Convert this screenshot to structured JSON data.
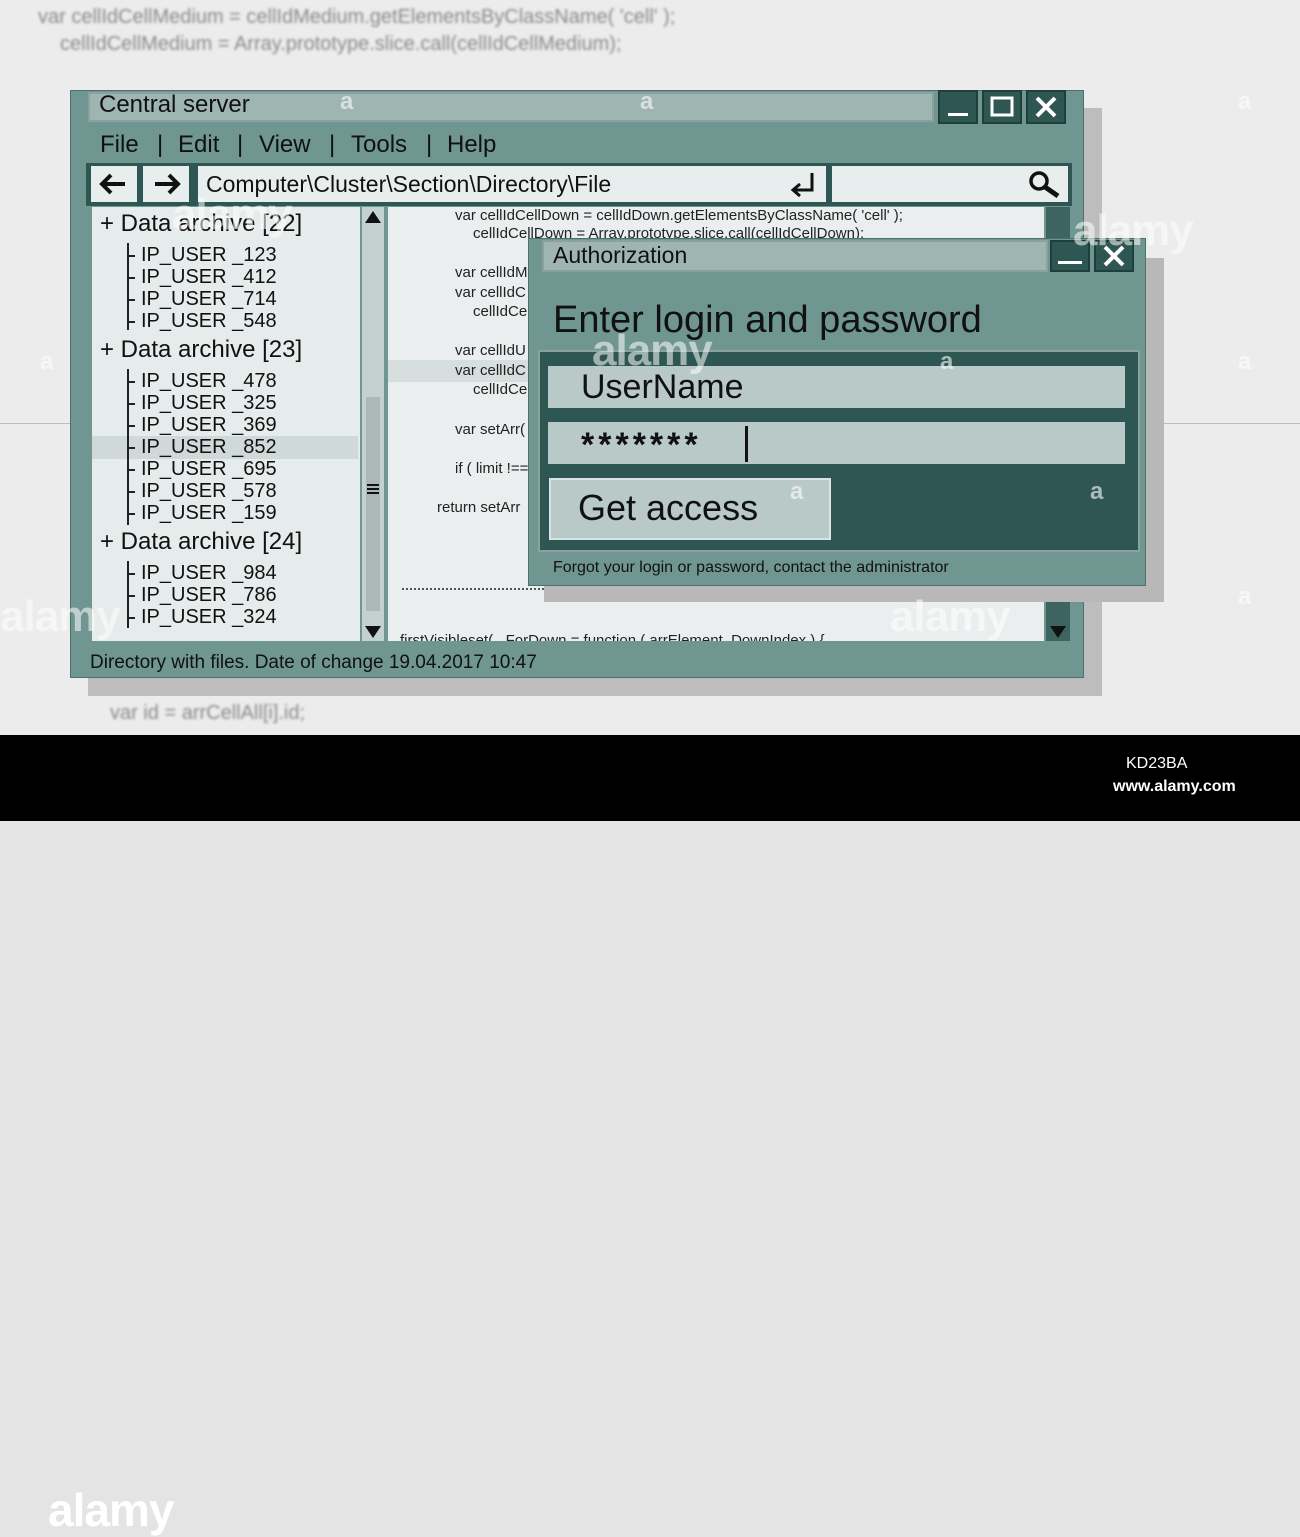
{
  "background_code": [
    "var cellIdCellMedium = cellIdMedium.getElementsByClassName( 'cell' );",
    "cellIdCellMedium = Array.prototype.slice.call(cellIdCellMedium);",
    "var id = arrCellAll[i].id;"
  ],
  "window": {
    "title": "Central server",
    "buttons": {
      "minimize": "_",
      "maximize": "□",
      "close": "X"
    }
  },
  "menu": [
    {
      "label": "File"
    },
    {
      "label": "Edit"
    },
    {
      "label": "View"
    },
    {
      "label": "Tools"
    },
    {
      "label": "Help"
    }
  ],
  "menu_separator": "|",
  "toolbar": {
    "back_icon": "arrow-left-icon",
    "forward_icon": "arrow-right-icon",
    "path": "Computer\\Cluster\\Section\\Directory\\File",
    "enter_icon": "enter-return-icon",
    "search_icon": "magnifier-icon",
    "search_value": ""
  },
  "tree": [
    {
      "label": "+ Data archive [22]",
      "users": [
        "IP_USER _123",
        "IP_USER _412",
        "IP_USER _714",
        "IP_USER _548"
      ]
    },
    {
      "label": "+ Data archive [23]",
      "users": [
        "IP_USER _478",
        "IP_USER _325",
        "IP_USER _369",
        "IP_USER _852",
        "IP_USER _695",
        "IP_USER _578",
        "IP_USER _159"
      ]
    },
    {
      "label": "+ Data archive [24]",
      "users": [
        "IP_USER _984",
        "IP_USER _786",
        "IP_USER _324"
      ]
    }
  ],
  "tree_selected": "IP_USER _852",
  "code_lines": [
    "var cellIdCellDown = cellIdDown.getElementsByClassName( 'cell' );",
    "cellIdCellDown = Array.prototype.slice.call(cellIdCellDown);",
    "var cellIdM",
    "var cellIdC",
    "cellIdCe",
    "var cellIdU",
    "var cellIdC",
    "cellIdCe",
    "var setArr(",
    "if ( limit !==",
    "return setArr",
    "firstVisibleset(...ForDown = function ( arrElement, DownIndex ) {"
  ],
  "status": "Directory with files. Date of change 19.04.2017  10:47",
  "dialog": {
    "title": "Authorization",
    "heading": "Enter login and password",
    "username_value": "UserName",
    "password_value": "*******",
    "button_label": "Get access",
    "forgot_text": "Forgot your login or password, contact the administrator"
  },
  "footer": {
    "brand": "alamy",
    "image_id": "KD23BA",
    "url": "www.alamy.com"
  },
  "colors": {
    "window_frame": "#6f9691",
    "dark_panel": "#2e5753",
    "title_bar": "#9fb5b2",
    "field": "#b8c9c7",
    "pane": "#e6ebeb"
  }
}
